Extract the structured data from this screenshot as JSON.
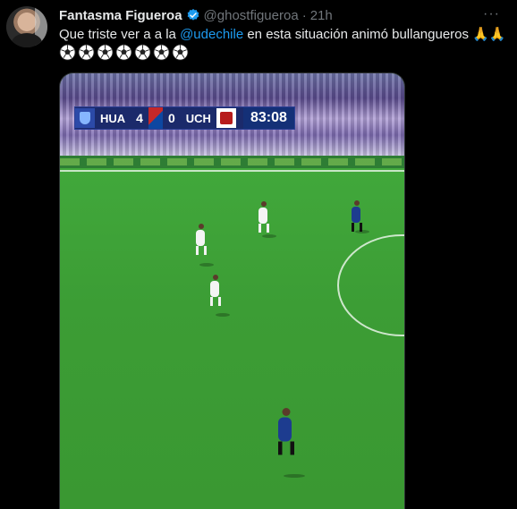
{
  "tweet": {
    "author_name": "Fantasma Figueroa",
    "handle": "@ghostfigueroa",
    "separator": "·",
    "time": "21h",
    "more": "···",
    "text_before": "Que triste ver a a la ",
    "mention": "@udechile",
    "text_after": " en esta situación animó bullangueros 🙏🙏",
    "emoji_count": 7
  },
  "media": {
    "scorebug": {
      "home_team": "HUA",
      "home_score": "4",
      "away_score": "0",
      "away_team": "UCH",
      "clock": "83:08"
    }
  },
  "colors": {
    "mention": "#1d9bf0",
    "secondary": "#71767b",
    "verified": "#1d9bf0",
    "pitch": "#3e9a35"
  }
}
